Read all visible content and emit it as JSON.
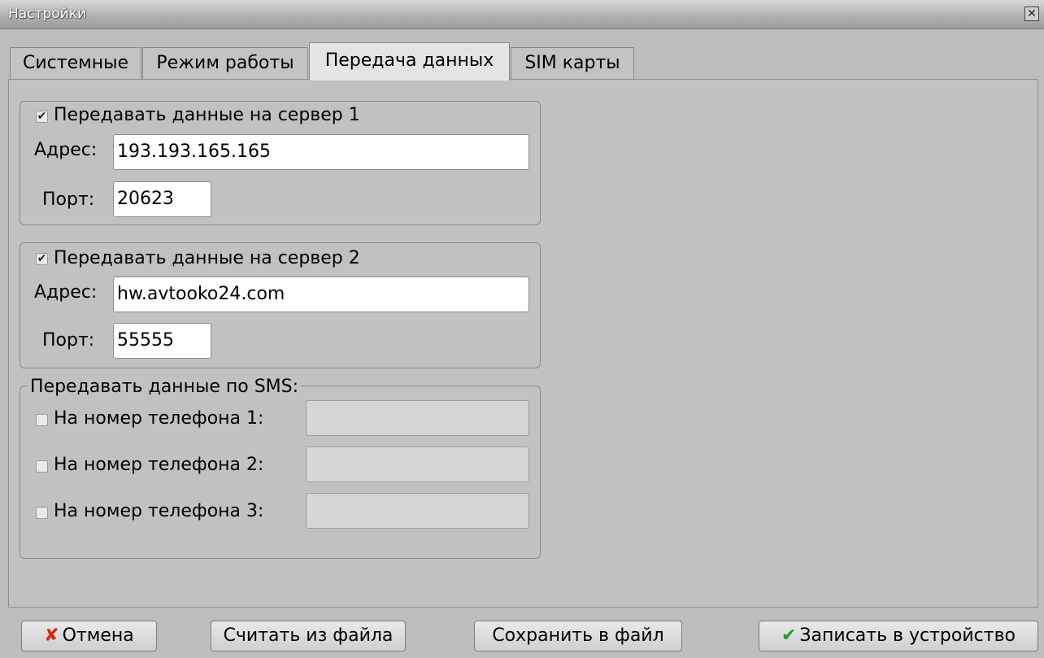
{
  "window": {
    "title": "Настройки",
    "close_glyph": "✕"
  },
  "tabs": [
    {
      "label": "Системные",
      "active": false
    },
    {
      "label": "Режим работы",
      "active": false
    },
    {
      "label": "Передача данных",
      "active": true
    },
    {
      "label": "SIM карты",
      "active": false
    }
  ],
  "server1": {
    "checkbox_label": "Передавать данные на сервер 1",
    "checked": true,
    "address_label": "Адрес:",
    "address_value": "193.193.165.165",
    "port_label": "Порт:",
    "port_value": "20623"
  },
  "server2": {
    "checkbox_label": "Передавать данные на сервер 2",
    "checked": true,
    "address_label": "Адрес:",
    "address_value": "hw.avtooko24.com",
    "port_label": "Порт:",
    "port_value": "55555"
  },
  "sms": {
    "legend": "Передавать данные по SMS:",
    "phones": [
      {
        "label": "На номер телефона 1:",
        "checked": false,
        "value": ""
      },
      {
        "label": "На номер телефона 2:",
        "checked": false,
        "value": ""
      },
      {
        "label": "На номер телефона 3:",
        "checked": false,
        "value": ""
      }
    ]
  },
  "buttons": {
    "cancel": {
      "label": "Отмена",
      "icon": "cross-icon",
      "icon_color": "#d42a10"
    },
    "load": {
      "label": "Считать из файла"
    },
    "save": {
      "label": "Сохранить в файл"
    },
    "write": {
      "label": "Записать в устройство",
      "icon": "checkmark-icon",
      "icon_color": "#1e9a1e"
    }
  },
  "colors": {
    "background": "#bdbdbd",
    "active_tab": "#e4e4e4"
  }
}
